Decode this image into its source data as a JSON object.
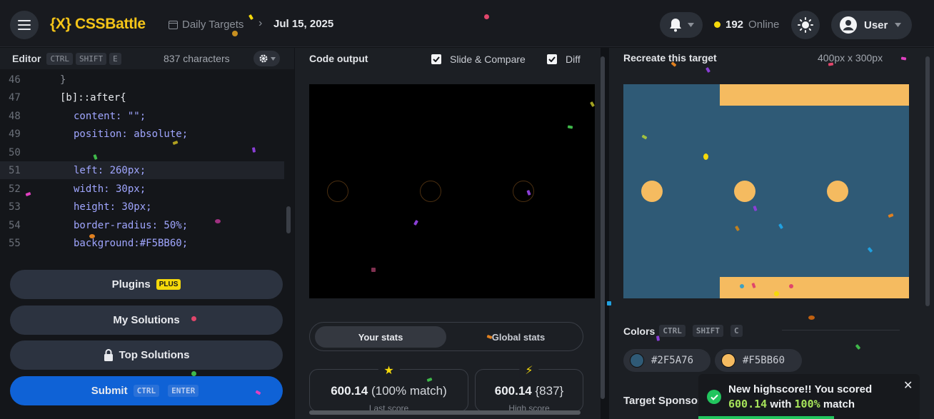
{
  "header": {
    "logo_text": "{X} CSSBattle",
    "breadcrumb_section": "Daily Targets",
    "breadcrumb_date": "Jul 15, 2025",
    "online_count": "192",
    "online_label": "Online",
    "user_label": "User"
  },
  "editor": {
    "title": "Editor",
    "shortcut_keys": [
      "CTRL",
      "SHIFT",
      "E"
    ],
    "char_count": "837 characters",
    "lines": [
      {
        "n": "46",
        "text": "}"
      },
      {
        "n": "47",
        "text": "[b]::after{"
      },
      {
        "n": "48",
        "text": "content: \"\";"
      },
      {
        "n": "49",
        "text": "position: absolute;"
      },
      {
        "n": "50",
        "text": ""
      },
      {
        "n": "51",
        "text": "left: 260px;"
      },
      {
        "n": "52",
        "text": "width: 30px;"
      },
      {
        "n": "53",
        "text": "height: 30px;"
      },
      {
        "n": "54",
        "text": "border-radius: 50%;"
      },
      {
        "n": "55",
        "text": "background:#F5BB60;"
      }
    ],
    "plugins_label": "Plugins",
    "plugins_badge": "PLUS",
    "my_solutions_label": "My Solutions",
    "top_solutions_label": "Top Solutions",
    "submit_label": "Submit",
    "submit_keys": [
      "CTRL",
      "ENTER"
    ]
  },
  "output": {
    "title": "Code output",
    "slide_compare_label": "Slide & Compare",
    "slide_compare_checked": true,
    "diff_label": "Diff",
    "diff_checked": true,
    "tab_your_stats": "Your stats",
    "tab_global_stats": "Global stats",
    "score_value": "600.14",
    "score_match": "(100% match)",
    "score_label": "Last score",
    "high_score_value": "600.14",
    "high_score_chars": "{837}",
    "high_score_label": "High score"
  },
  "target": {
    "title": "Recreate this target",
    "size": "400px x 300px",
    "colors_title": "Colors",
    "colors_keys": [
      "CTRL",
      "SHIFT",
      "C"
    ],
    "colors": [
      {
        "hex": "#2F5A76"
      },
      {
        "hex": "#F5BB60"
      }
    ],
    "sponsor_label": "Target Sponsor"
  },
  "toast": {
    "line1": "New highscore!! You scored",
    "score": "600.14",
    "with": "with",
    "match": "100%",
    "match_word": "match"
  }
}
